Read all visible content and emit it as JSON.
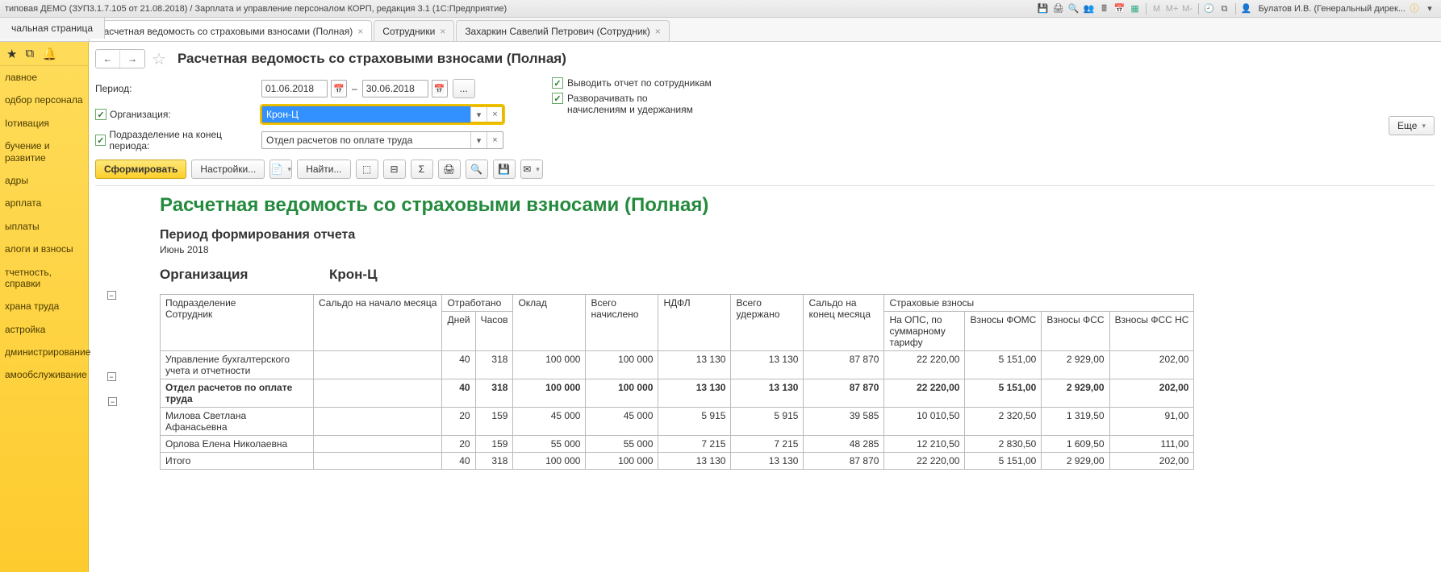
{
  "title": "типовая ДЕМО (ЗУП3.1.7.105 от 21.08.2018) / Зарплата и управление персоналом КОРП, редакция 3.1  (1С:Предприятие)",
  "user": "Булатов И.В. (Генеральный дирек...",
  "tabs": {
    "start": "чальная страница",
    "items": [
      {
        "label": "Расчетная ведомость со страховыми взносами (Полная)",
        "close": true,
        "active": true
      },
      {
        "label": "Сотрудники",
        "close": true
      },
      {
        "label": "Захаркин Савелий Петрович (Сотрудник)",
        "close": true
      }
    ]
  },
  "sidebar": {
    "items": [
      "лавное",
      "одбор персонала",
      "Іотивация",
      "бучение и развитие",
      "адры",
      "арплата",
      "ыплаты",
      "алоги и взносы",
      "тчетность, справки",
      "храна труда",
      "астройка",
      "дминистрирование",
      "амообслуживание"
    ]
  },
  "page": {
    "title": "Расчетная ведомость со страховыми взносами (Полная)"
  },
  "form": {
    "period_label": "Период:",
    "date_from": "01.06.2018",
    "date_to": "30.06.2018",
    "dots": "...",
    "dash": "–",
    "org_label": "Организация:",
    "org_value": "Крон-Ц",
    "subdiv_label": "Подразделение на конец периода:",
    "subdiv_value": "Отдел расчетов по оплате труда",
    "check1": "Выводить отчет по сотрудникам",
    "check2a": "Разворачивать по",
    "check2b": "начислениям и удержаниям"
  },
  "toolbar": {
    "generate": "Сформировать",
    "settings": "Настройки...",
    "find": "Найти...",
    "more": "Еще"
  },
  "report": {
    "title": "Расчетная ведомость со страховыми взносами (Полная)",
    "period_head": "Период формирования отчета",
    "period_val": "Июнь 2018",
    "org_lbl": "Организация",
    "org_val": "Крон-Ц",
    "cols": {
      "c1": "Подразделение",
      "c1b": "Сотрудник",
      "c2": "Сальдо на начало месяца",
      "c3": "Отработано",
      "c3a": "Дней",
      "c3b": "Часов",
      "c4": "Оклад",
      "c5": "Всего начислено",
      "c6": "НДФЛ",
      "c7": "Всего удержано",
      "c8": "Сальдо на конец месяца",
      "c9": "Страховые взносы",
      "c9a": "На ОПС, по суммарному тарифу",
      "c9b": "Взносы ФОМС",
      "c9c": "Взносы ФСС",
      "c9d": "Взносы ФСС НС"
    },
    "rows": [
      {
        "name": "Управление бухгалтерского учета и отчетности",
        "d": "40",
        "h": "318",
        "okl": "100 000",
        "nach": "100 000",
        "ndfl": "13 130",
        "ud": "13 130",
        "saldo": "87 870",
        "ops": "22 220,00",
        "foms": "5 151,00",
        "fss": "2 929,00",
        "fssns": "202,00"
      },
      {
        "name": "Отдел расчетов по оплате труда",
        "d": "40",
        "h": "318",
        "okl": "100 000",
        "nach": "100 000",
        "ndfl": "13 130",
        "ud": "13 130",
        "saldo": "87 870",
        "ops": "22 220,00",
        "foms": "5 151,00",
        "fss": "2 929,00",
        "fssns": "202,00",
        "bold": true
      },
      {
        "name": "Милова Светлана Афанасьевна",
        "d": "20",
        "h": "159",
        "okl": "45 000",
        "nach": "45 000",
        "ndfl": "5 915",
        "ud": "5 915",
        "saldo": "39 585",
        "ops": "10 010,50",
        "foms": "2 320,50",
        "fss": "1 319,50",
        "fssns": "91,00"
      },
      {
        "name": "Орлова Елена Николаевна",
        "d": "20",
        "h": "159",
        "okl": "55 000",
        "nach": "55 000",
        "ndfl": "7 215",
        "ud": "7 215",
        "saldo": "48 285",
        "ops": "12 210,50",
        "foms": "2 830,50",
        "fss": "1 609,50",
        "fssns": "111,00"
      },
      {
        "name": "Итого",
        "d": "40",
        "h": "318",
        "okl": "100 000",
        "nach": "100 000",
        "ndfl": "13 130",
        "ud": "13 130",
        "saldo": "87 870",
        "ops": "22 220,00",
        "foms": "5 151,00",
        "fss": "2 929,00",
        "fssns": "202,00"
      }
    ]
  },
  "chart_data": {
    "type": "table",
    "title": "Расчетная ведомость со страховыми взносами (Полная) — Июнь 2018, Крон-Ц",
    "columns": [
      "Подразделение/Сотрудник",
      "Дней",
      "Часов",
      "Оклад",
      "Всего начислено",
      "НДФЛ",
      "Всего удержано",
      "Сальдо на конец месяца",
      "На ОПС",
      "Взносы ФОМС",
      "Взносы ФСС",
      "Взносы ФСС НС"
    ],
    "rows": [
      [
        "Управление бухгалтерского учета и отчетности",
        40,
        318,
        100000,
        100000,
        13130,
        13130,
        87870,
        22220.0,
        5151.0,
        2929.0,
        202.0
      ],
      [
        "Отдел расчетов по оплате труда",
        40,
        318,
        100000,
        100000,
        13130,
        13130,
        87870,
        22220.0,
        5151.0,
        2929.0,
        202.0
      ],
      [
        "Милова Светлана Афанасьевна",
        20,
        159,
        45000,
        45000,
        5915,
        5915,
        39585,
        10010.5,
        2320.5,
        1319.5,
        91.0
      ],
      [
        "Орлова Елена Николаевна",
        20,
        159,
        55000,
        55000,
        7215,
        7215,
        48285,
        12210.5,
        2830.5,
        1609.5,
        111.0
      ],
      [
        "Итого",
        40,
        318,
        100000,
        100000,
        13130,
        13130,
        87870,
        22220.0,
        5151.0,
        2929.0,
        202.0
      ]
    ]
  }
}
